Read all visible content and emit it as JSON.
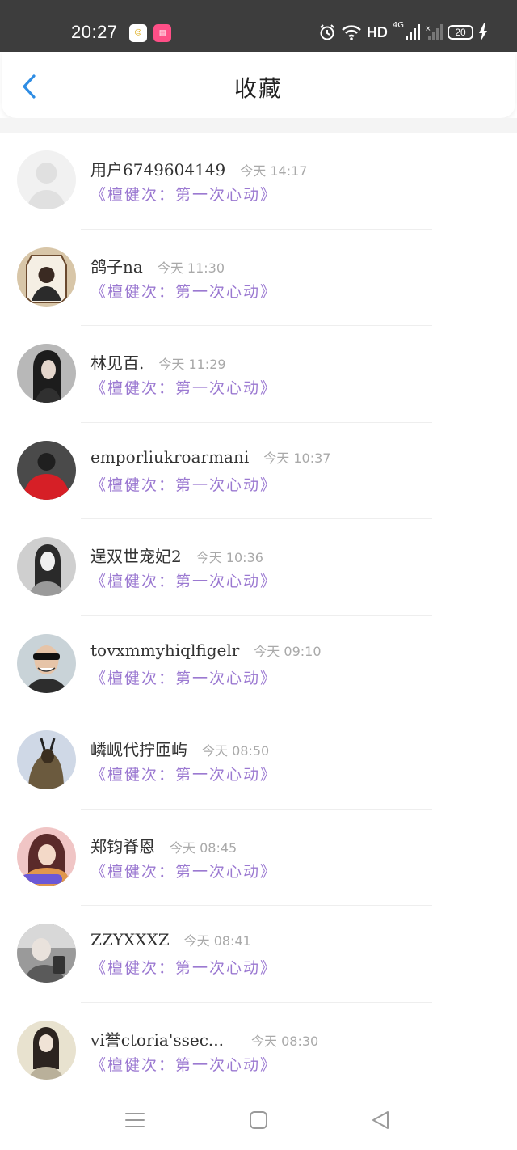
{
  "status_bar": {
    "time": "20:27",
    "network": "HD",
    "signal": "4G",
    "battery": "20"
  },
  "header": {
    "title": "收藏"
  },
  "colors": {
    "accent": "#2f8de4",
    "book_title": "#9b79d1",
    "time": "#a9a9a9"
  },
  "items": [
    {
      "name": "用户6749604149",
      "time": "今天 14:17",
      "book": "《檀健次：第一次心动》",
      "avatar": "default-avatar"
    },
    {
      "name": "鸽子na",
      "time": "今天 11:30",
      "book": "《檀健次：第一次心动》",
      "avatar": "photo-avatar"
    },
    {
      "name": "林见百.",
      "time": "今天 11:29",
      "book": "《檀健次：第一次心动》",
      "avatar": "photo-avatar"
    },
    {
      "name": "emporliukroarmani",
      "time": "今天 10:37",
      "book": "《檀健次：第一次心动》",
      "avatar": "photo-avatar"
    },
    {
      "name": "逞双世宠妃2",
      "time": "今天 10:36",
      "book": "《檀健次：第一次心动》",
      "avatar": "photo-avatar"
    },
    {
      "name": "tovxmmyhiqlfigelr",
      "time": "今天 09:10",
      "book": "《檀健次：第一次心动》",
      "avatar": "photo-avatar"
    },
    {
      "name": "嶙岘代拧匝屿",
      "time": "今天 08:50",
      "book": "《檀健次：第一次心动》",
      "avatar": "photo-avatar"
    },
    {
      "name": "郑钧脊恩",
      "time": "今天 08:45",
      "book": "《檀健次：第一次心动》",
      "avatar": "photo-avatar"
    },
    {
      "name": "ZZYXXXZ",
      "time": "今天 08:41",
      "book": "《檀健次：第一次心动》",
      "avatar": "photo-avatar"
    },
    {
      "name": "vi誉ctoria'ssec...",
      "time": "今天 08:30",
      "book": "《檀健次：第一次心动》",
      "avatar": "photo-avatar"
    }
  ],
  "nav_bar": {
    "icons": [
      "menu-icon",
      "home-square-icon",
      "back-triangle-icon"
    ]
  }
}
